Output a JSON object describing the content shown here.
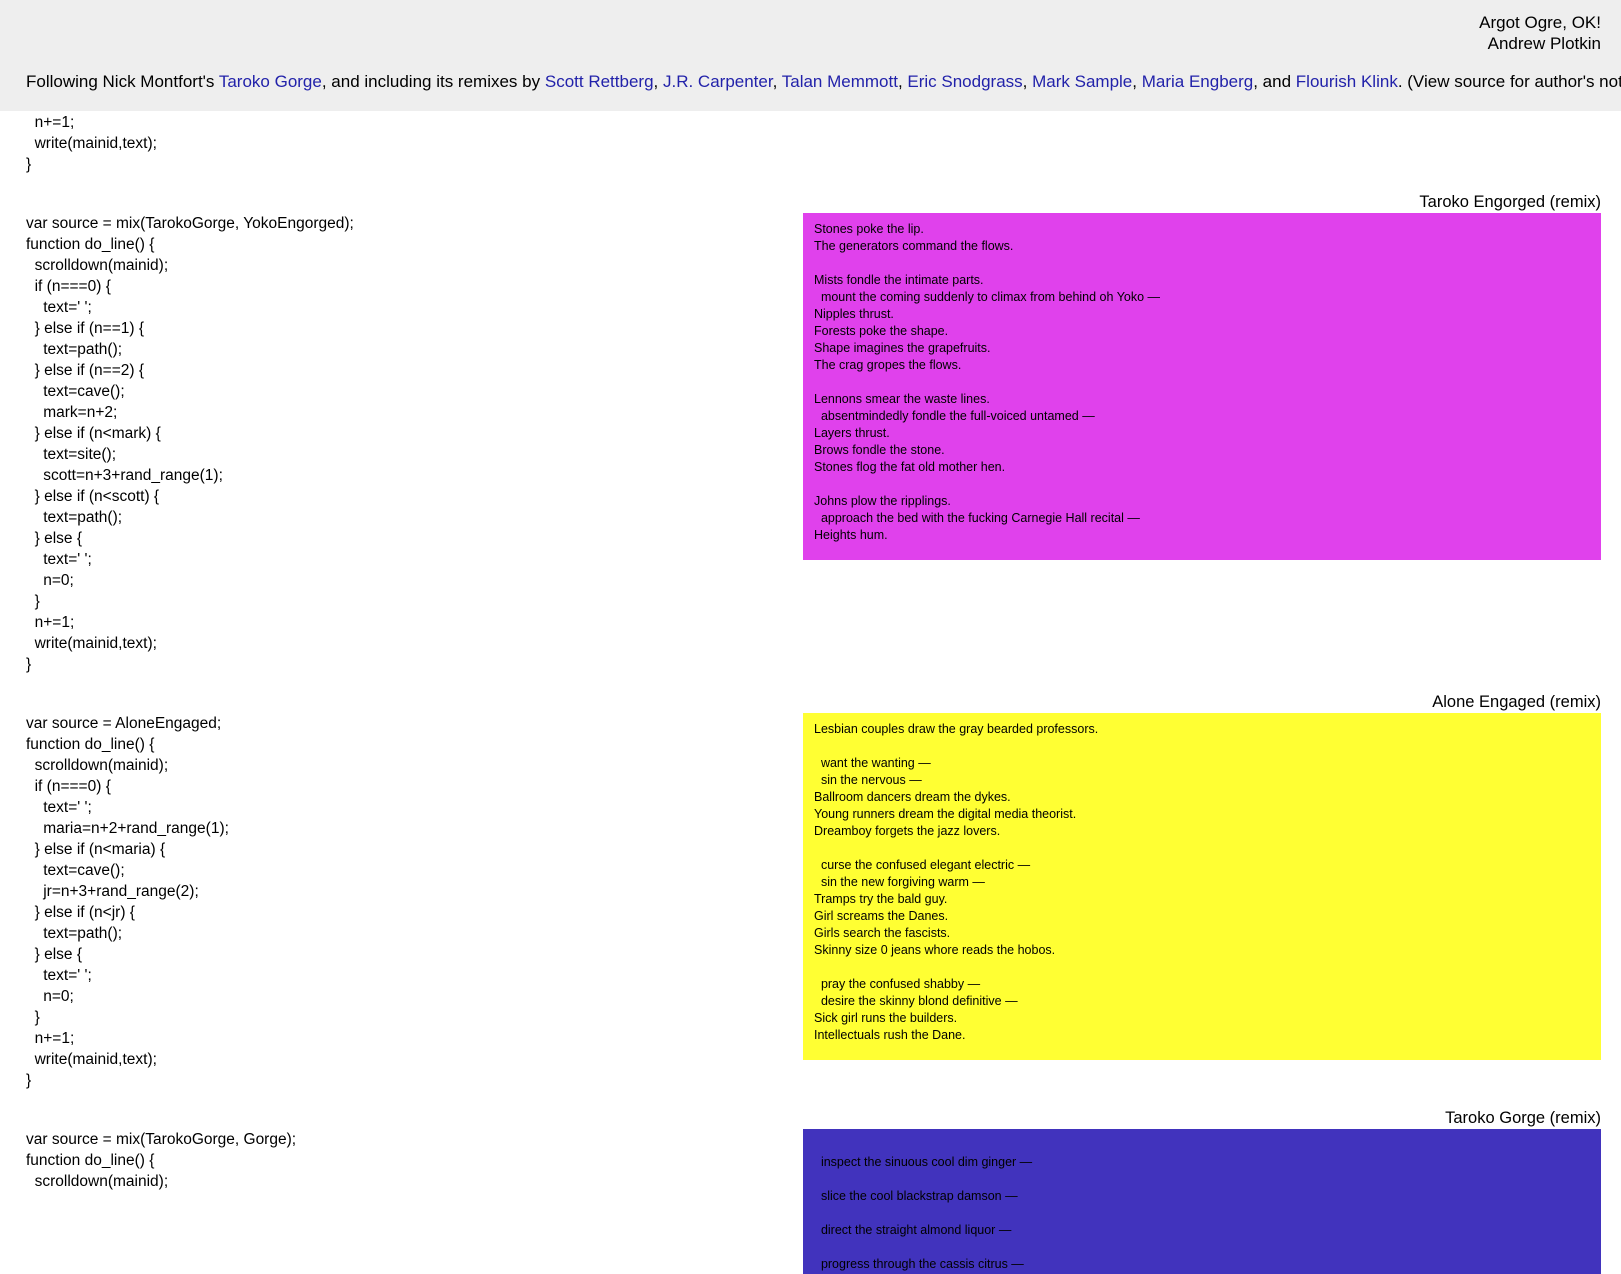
{
  "header": {
    "title": "Argot Ogre, OK!",
    "author": "Andrew Plotkin",
    "credits": {
      "intro": "Following Nick Montfort's",
      "taroko_link": "Taroko Gorge",
      "mid": ", and including its remixes by",
      "links": [
        "Scott Rettberg",
        "J.R. Carpenter",
        "Talan Memmott",
        "Eric Snodgrass",
        "Mark Sample",
        "Maria Engberg",
        "Flourish Klink"
      ],
      "sep": ", ",
      "and": ", and ",
      "tail": ". (View source for author's notes.)"
    }
  },
  "code_top": [
    "  n+=1;",
    "  write(mainid,text);",
    "}"
  ],
  "sections": [
    {
      "title": "Taroko Engorged (remix)",
      "bg": "#e041ec",
      "code": [
        "var source = mix(TarokoGorge, YokoEngorged);",
        "function do_line() {",
        "  scrolldown(mainid);",
        "  if (n===0) {",
        "    text=' ';",
        "  } else if (n==1) {",
        "    text=path();",
        "  } else if (n==2) {",
        "    text=cave();",
        "    mark=n+2;",
        "  } else if (n<mark) {",
        "    text=site();",
        "    scott=n+3+rand_range(1);",
        "  } else if (n<scott) {",
        "    text=path();",
        "  } else {",
        "    text=' ';",
        "    n=0;",
        "  }",
        "  n+=1;",
        "  write(mainid,text);",
        "}"
      ],
      "poem": [
        "Stones poke the lip.",
        "The generators command the flows.",
        "",
        "Mists fondle the intimate parts.",
        "  mount the coming suddenly to climax from behind oh Yoko —",
        "Nipples thrust.",
        "Forests poke the shape.",
        "Shape imagines the grapefruits.",
        "The crag gropes the flows.",
        "",
        "Lennons smear the waste lines.",
        "  absentmindedly fondle the full-voiced untamed —",
        "Layers thrust.",
        "Brows fondle the stone.",
        "Stones flog the fat old mother hen.",
        "",
        "Johns plow the ripplings.",
        "  approach the bed with the fucking Carnegie Hall recital —",
        "Heights hum."
      ]
    },
    {
      "title": "Alone Engaged (remix)",
      "bg": "#ffff33",
      "code": [
        "var source = AloneEngaged;",
        "function do_line() {",
        "  scrolldown(mainid);",
        "  if (n===0) {",
        "    text=' ';",
        "    maria=n+2+rand_range(1);",
        "  } else if (n<maria) {",
        "    text=cave();",
        "    jr=n+3+rand_range(2);",
        "  } else if (n<jr) {",
        "    text=path();",
        "  } else {",
        "    text=' ';",
        "    n=0;",
        "  }",
        "  n+=1;",
        "  write(mainid,text);",
        "}"
      ],
      "poem": [
        "Lesbian couples draw the gray bearded professors.",
        "",
        "  want the wanting —",
        "  sin the nervous —",
        "Ballroom dancers dream the dykes.",
        "Young runners dream the digital media theorist.",
        "Dreamboy forgets the jazz lovers.",
        "",
        "  curse the confused elegant electric —",
        "  sin the new forgiving warm —",
        "Tramps try the bald guy.",
        "Girl screams the Danes.",
        "Girls search the fascists.",
        "Skinny size 0 jeans whore reads the hobos.",
        "",
        "  pray the confused shabby —",
        "  desire the skinny blond definitive —",
        "Sick girl runs the builders.",
        "Intellectuals rush the Dane."
      ]
    },
    {
      "title": "Taroko Gorge (remix)",
      "bg": "#4133bd",
      "code": [
        "var source = mix(TarokoGorge, Gorge);",
        "function do_line() {",
        "  scrolldown(mainid);"
      ],
      "poem": [
        "",
        "  inspect the sinuous cool dim ginger —",
        "",
        "  slice the cool blackstrap damson —",
        "",
        "  direct the straight almond liquor —",
        "",
        "  progress through the cassis citrus —"
      ]
    }
  ]
}
